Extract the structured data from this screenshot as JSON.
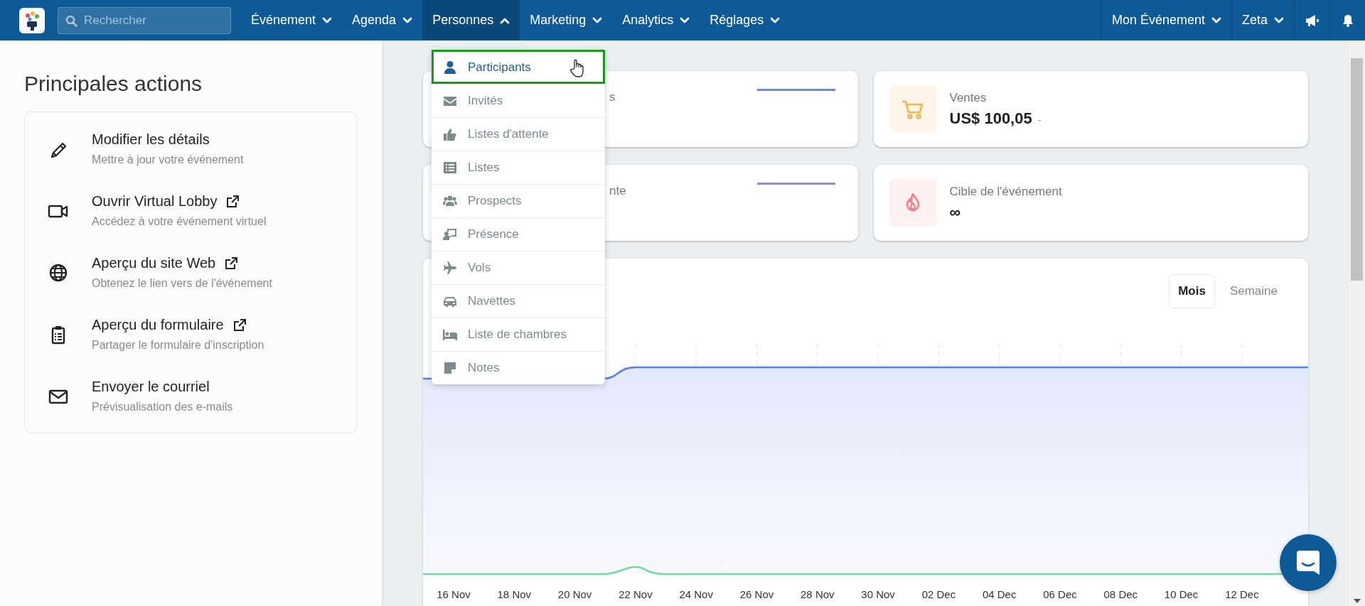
{
  "topbar": {
    "search_placeholder": "Rechercher",
    "nav": [
      {
        "label": "Événement",
        "selected": false
      },
      {
        "label": "Agenda",
        "selected": false
      },
      {
        "label": "Personnes",
        "selected": true
      },
      {
        "label": "Marketing",
        "selected": false
      },
      {
        "label": "Analytics",
        "selected": false
      },
      {
        "label": "Réglages",
        "selected": false
      }
    ],
    "event_menu": "Mon Événement",
    "user_menu": "Zeta"
  },
  "sidebar": {
    "title": "Principales actions",
    "actions": [
      {
        "title": "Modifier les détails",
        "subtitle": "Mettre à jour votre événement",
        "external": false
      },
      {
        "title": "Ouvrir Virtual Lobby",
        "subtitle": "Accédez à votre événement virtuel",
        "external": true
      },
      {
        "title": "Aperçu du site Web",
        "subtitle": "Obtenez le lien vers de l'événement",
        "external": true
      },
      {
        "title": "Aperçu du formulaire",
        "subtitle": "Partager le formulaire d'inscription",
        "external": true
      },
      {
        "title": "Envoyer le courriel",
        "subtitle": "Prévisualisation des e-mails",
        "external": false
      }
    ]
  },
  "stats": [
    {
      "kind": "sparkline",
      "label": "s",
      "color": "#6b86ea"
    },
    {
      "kind": "icon",
      "label": "Ventes",
      "value": "US$ 100,05",
      "change": "-"
    },
    {
      "kind": "sparkline",
      "label": "nte",
      "color": "#8c8ed8"
    },
    {
      "kind": "icon",
      "label": "Cible de l'événement",
      "value": "∞"
    }
  ],
  "chart": {
    "periods": [
      {
        "label": "Mois",
        "selected": true
      },
      {
        "label": "Semaine",
        "selected": false
      }
    ],
    "x_labels": [
      "16 Nov",
      "18 Nov",
      "20 Nov",
      "22 Nov",
      "24 Nov",
      "26 Nov",
      "28 Nov",
      "30 Nov",
      "02 Dec",
      "04 Dec",
      "06 Dec",
      "08 Dec",
      "10 Dec",
      "12 Dec"
    ]
  },
  "people_menu": {
    "items": [
      {
        "label": "Participants",
        "selected": true
      },
      {
        "label": "Invités",
        "selected": false
      },
      {
        "label": "Listes d'attente",
        "selected": false
      },
      {
        "label": "Listes",
        "selected": false
      },
      {
        "label": "Prospects",
        "selected": false
      },
      {
        "label": "Présence",
        "selected": false
      },
      {
        "label": "Vols",
        "selected": false
      },
      {
        "label": "Navettes",
        "selected": false
      },
      {
        "label": "Liste de chambres",
        "selected": false
      },
      {
        "label": "Notes",
        "selected": false
      }
    ]
  }
}
